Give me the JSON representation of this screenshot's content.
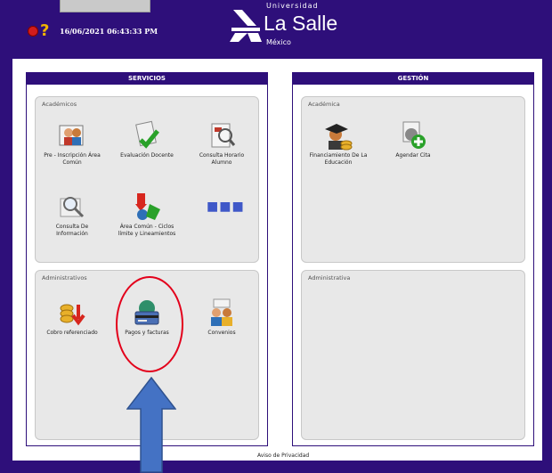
{
  "header": {
    "datetime": "16/06/2021 06:43:33 PM",
    "logo_top": "Universidad",
    "logo_main": "La Salle",
    "logo_sub": "México"
  },
  "servicios": {
    "title": "SERVICIOS",
    "academicos": {
      "title": "Académicos",
      "items": [
        {
          "label": "Pre - Inscripción Área Común",
          "icon": "students-icon"
        },
        {
          "label": "Evaluación Docente",
          "icon": "checklist-icon"
        },
        {
          "label": "Consulta Horario Alumno",
          "icon": "schedule-icon"
        },
        {
          "label": "Consulta De Información",
          "icon": "magnifier-icon"
        },
        {
          "label": "Área Común - Ciclos límite y Lineamientos",
          "icon": "shapes-icon"
        },
        {
          "label": "",
          "icon": "more-icon"
        }
      ]
    },
    "administrativos": {
      "title": "Administrativos",
      "items": [
        {
          "label": "Cobro referenciado",
          "icon": "coins-icon"
        },
        {
          "label": "Pagos y facturas",
          "icon": "payment-card-icon"
        },
        {
          "label": "Convenios",
          "icon": "agreement-icon"
        }
      ]
    }
  },
  "gestion": {
    "title": "GESTIÓN",
    "academica": {
      "title": "Académica",
      "items": [
        {
          "label": "Financiamiento De La Educación",
          "icon": "graduate-icon"
        },
        {
          "label": "Agendar Cita",
          "icon": "appointment-icon"
        }
      ]
    },
    "administrativa": {
      "title": "Administrativa"
    }
  },
  "footer": {
    "privacy": "Aviso de Privacidad"
  },
  "colors": {
    "frame": "#2e0f7a",
    "annotation_circle": "#e3001b",
    "annotation_arrow": "#4472c4"
  }
}
